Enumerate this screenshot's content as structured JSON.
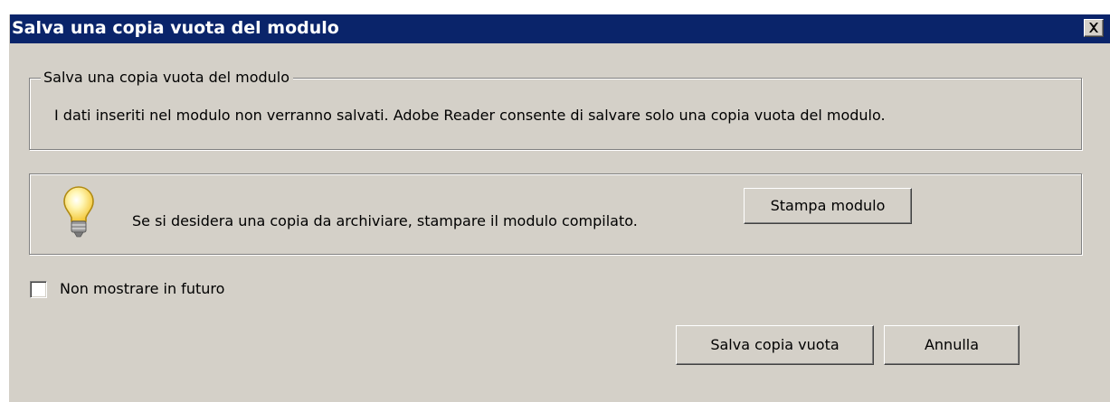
{
  "window": {
    "title": "Salva una copia vuota del modulo",
    "close_icon": "close-icon"
  },
  "group": {
    "legend": "Salva una copia vuota del modulo",
    "message": "I dati inseriti nel modulo non verranno salvati. Adobe Reader consente di salvare solo una copia vuota del modulo."
  },
  "tip": {
    "icon": "lightbulb-icon",
    "text": "Se si desidera una copia da archiviare, stampare il modulo compilato.",
    "print_button_label": "Stampa modulo"
  },
  "options": {
    "dont_show_label": "Non mostrare in futuro",
    "dont_show_checked": false
  },
  "actions": {
    "save_label": "Salva copia vuota",
    "cancel_label": "Annulla"
  },
  "colors": {
    "titlebar": "#0a246a",
    "dialog_background": "#d4d0c8",
    "title_text": "#ffffff"
  }
}
